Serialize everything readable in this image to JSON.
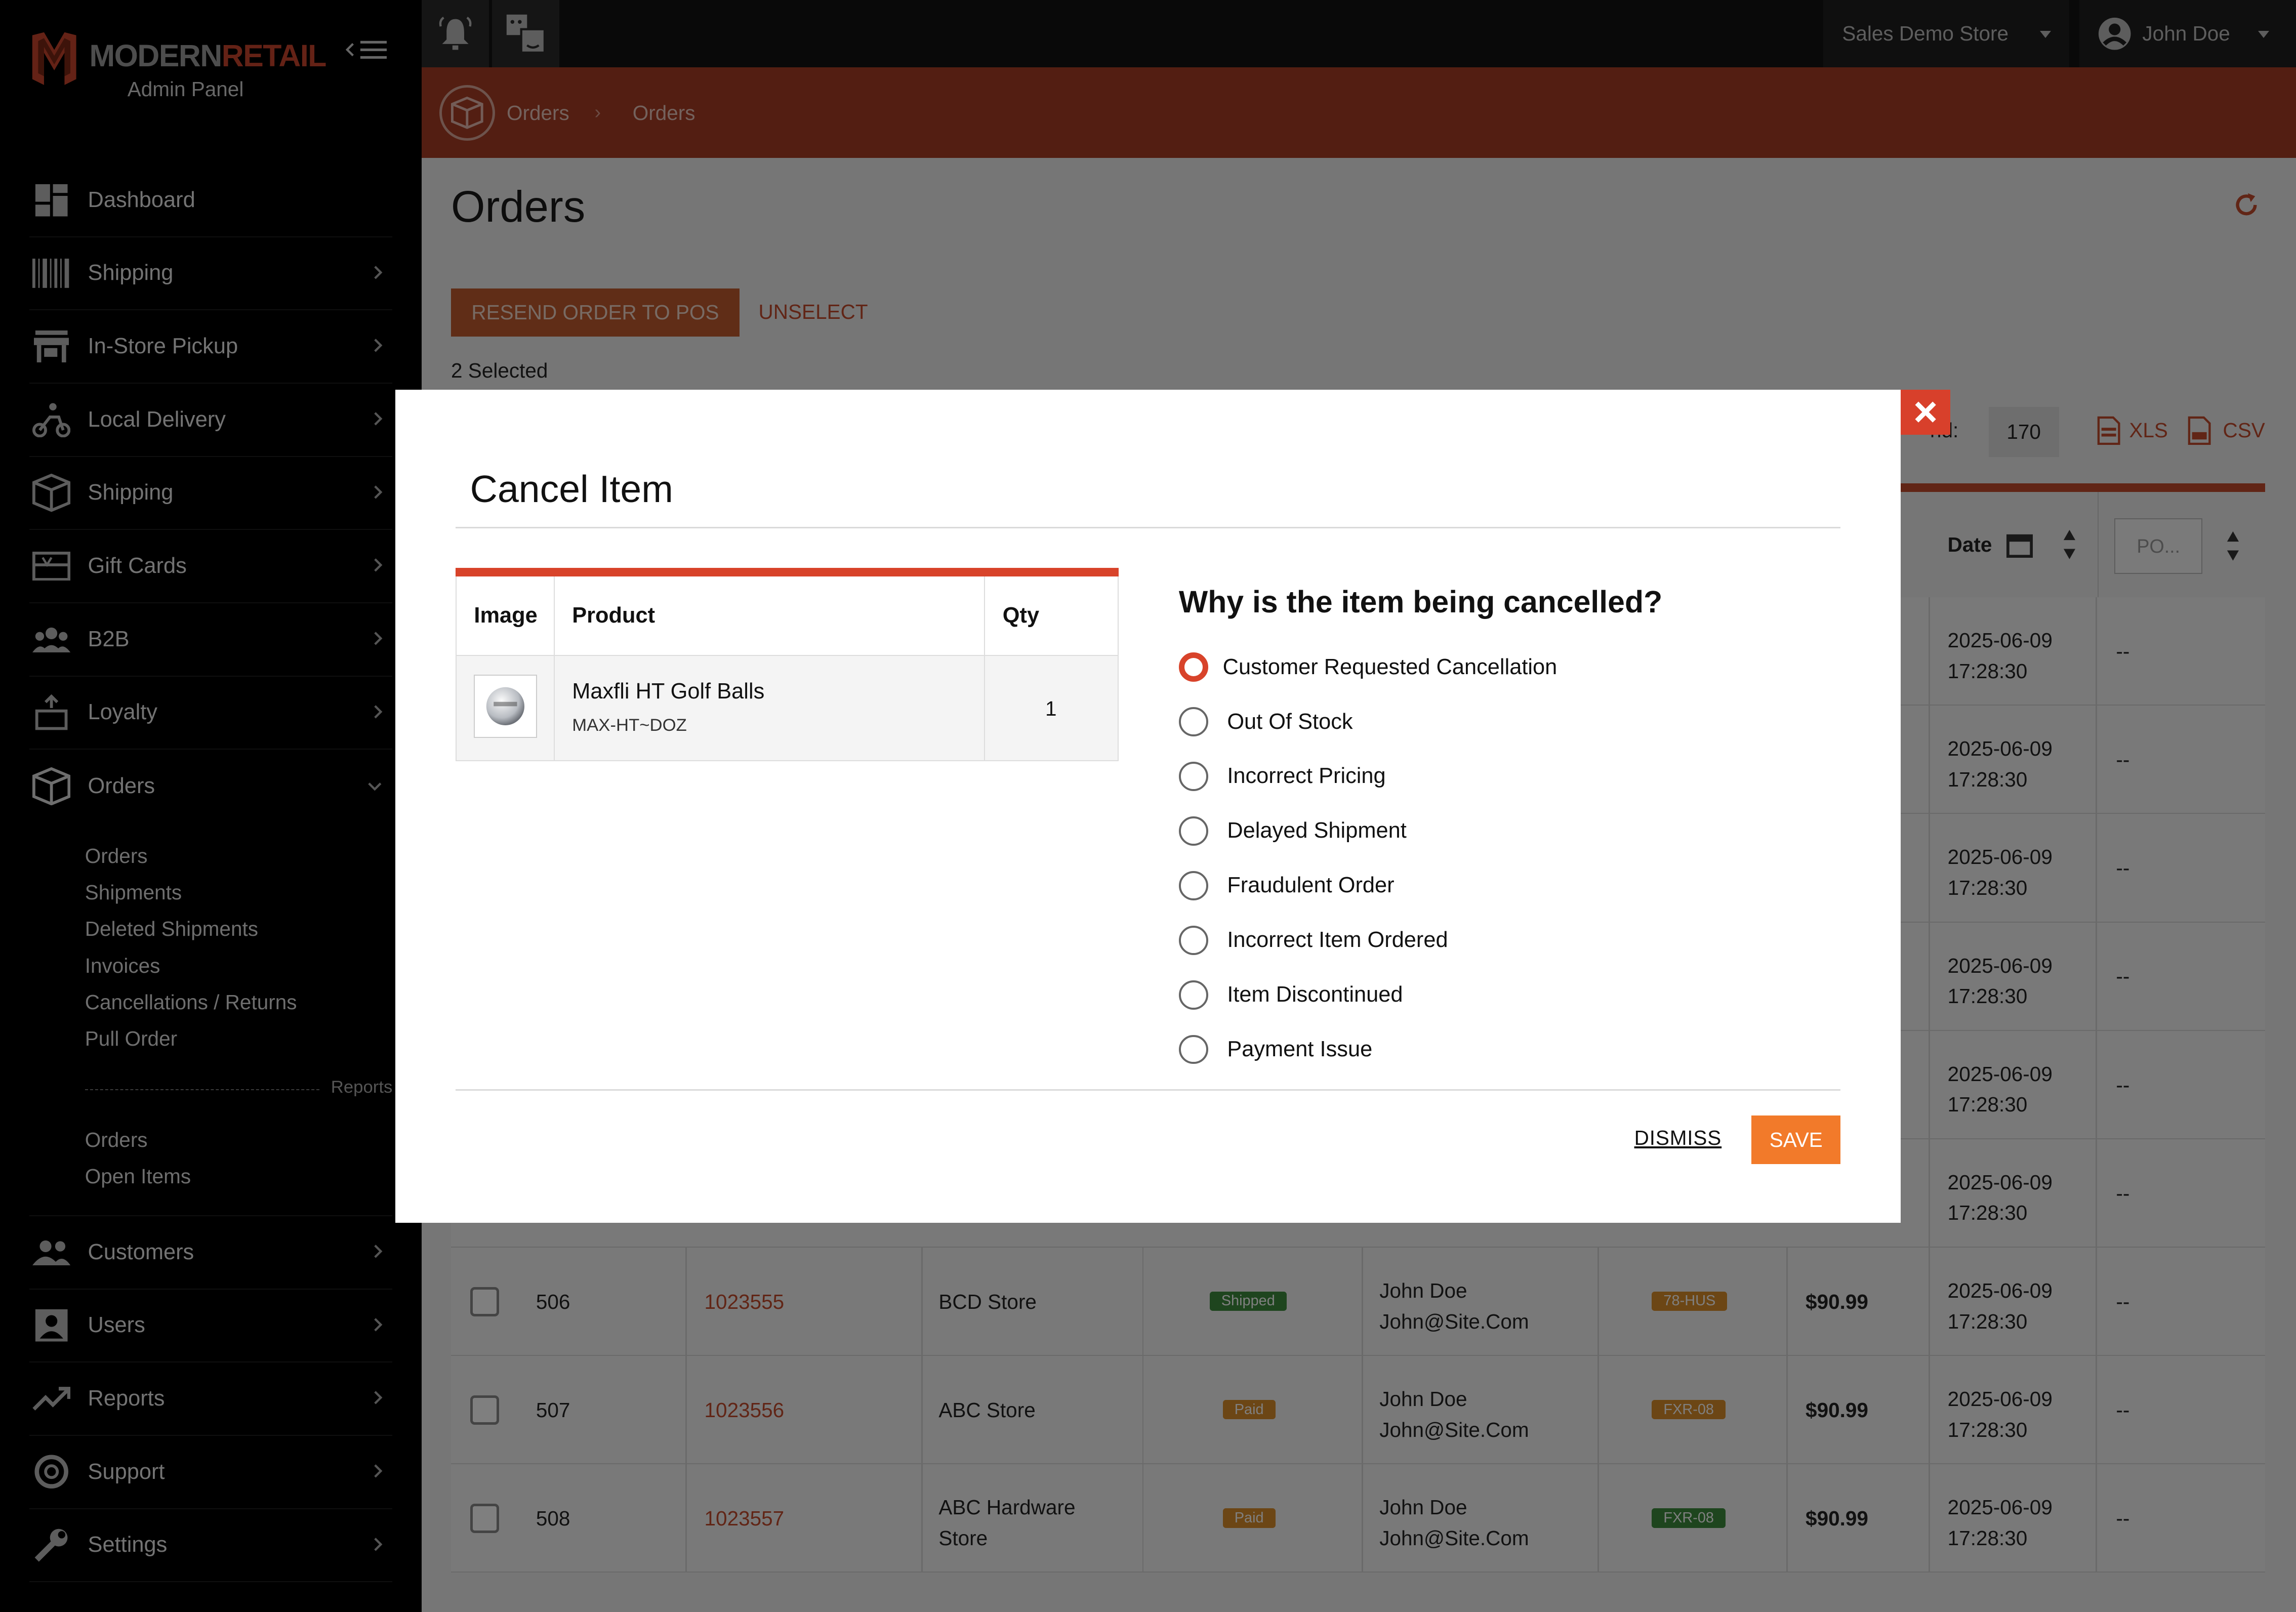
{
  "brand": {
    "part1": "MODERN",
    "part2": "RETAIL",
    "subtitle": "Admin Panel"
  },
  "topbar": {
    "store": "Sales Demo Store",
    "user": "John Doe"
  },
  "breadcrumb": {
    "items": [
      "Orders",
      "Orders"
    ],
    "separator": "›"
  },
  "sidebar": {
    "items": [
      {
        "label": "Dashboard",
        "icon": "dashboard-icon"
      },
      {
        "label": "Shipping",
        "icon": "barcode-icon"
      },
      {
        "label": "In-Store Pickup",
        "icon": "store-icon"
      },
      {
        "label": "Local Delivery",
        "icon": "scooter-icon"
      },
      {
        "label": "Shipping",
        "icon": "package-icon"
      },
      {
        "label": "Gift Cards",
        "icon": "gift-card-icon"
      },
      {
        "label": "B2B",
        "icon": "group-icon"
      },
      {
        "label": "Loyalty",
        "icon": "loyalty-icon"
      },
      {
        "label": "Orders",
        "icon": "orders-icon"
      }
    ],
    "orders_sub": [
      "Orders",
      "Shipments",
      "Deleted Shipments",
      "Invoices",
      "Cancellations / Returns",
      "Pull Order"
    ],
    "reports_label": "Reports",
    "reports_sub": [
      "Orders",
      "Open Items"
    ],
    "items_bottom": [
      {
        "label": "Customers",
        "icon": "customers-icon"
      },
      {
        "label": "Users",
        "icon": "user-icon"
      },
      {
        "label": "Reports",
        "icon": "trend-icon"
      },
      {
        "label": "Support",
        "icon": "lifebuoy-icon"
      },
      {
        "label": "Settings",
        "icon": "wrench-icon"
      }
    ]
  },
  "main": {
    "title": "Orders",
    "resend_label": "RESEND ORDER TO POS",
    "unselect_label": "UNSELECT",
    "selected_text": "2 Selected",
    "found_label": "nd:",
    "found_value": "170",
    "export_xls": "XLS",
    "export_csv": "CSV",
    "col_date": "Date",
    "col_po": "PO..."
  },
  "rows_hidden": [
    {
      "date": "2025-06-09",
      "time": "17:28:30",
      "po": "--"
    },
    {
      "date": "2025-06-09",
      "time": "17:28:30",
      "po": "--"
    },
    {
      "date": "2025-06-09",
      "time": "17:28:30",
      "po": "--"
    },
    {
      "date": "2025-06-09",
      "time": "17:28:30",
      "po": "--"
    },
    {
      "date": "2025-06-09",
      "time": "17:28:30",
      "po": "--"
    },
    {
      "date": "2025-06-09",
      "time": "17:28:30",
      "po": "--"
    }
  ],
  "rows": [
    {
      "id": "506",
      "order": "1023555",
      "store": "BCD Store",
      "store2": "",
      "status": "Shipped",
      "status_color": "#3d8a3d",
      "customer": "John Doe",
      "email": "John@Site.Com",
      "tag": "78-HUS",
      "tag_color": "#d98c2a",
      "total": "$90.99",
      "date": "2025-06-09",
      "time": "17:28:30",
      "po": "--"
    },
    {
      "id": "507",
      "order": "1023556",
      "store": "ABC Store",
      "store2": "",
      "status": "Paid",
      "status_color": "#d98c2a",
      "customer": "John Doe",
      "email": "John@Site.Com",
      "tag": "FXR-08",
      "tag_color": "#d98c2a",
      "total": "$90.99",
      "date": "2025-06-09",
      "time": "17:28:30",
      "po": "--"
    },
    {
      "id": "508",
      "order": "1023557",
      "store": "ABC Hardware",
      "store2": "Store",
      "status": "Paid",
      "status_color": "#d98c2a",
      "customer": "John Doe",
      "email": "John@Site.Com",
      "tag": "FXR-08",
      "tag_color": "#3d8a3d",
      "total": "$90.99",
      "date": "2025-06-09",
      "time": "17:28:30",
      "po": "--"
    }
  ],
  "modal": {
    "title": "Cancel Item",
    "table_headers": [
      "Image",
      "Product",
      "Qty"
    ],
    "item": {
      "name": "Maxfli HT Golf Balls",
      "sku": "MAX-HT~DOZ",
      "qty": "1"
    },
    "question": "Why is the item being cancelled?",
    "reasons": [
      "Customer Requested Cancellation",
      "Out Of Stock",
      "Incorrect Pricing",
      "Delayed Shipment",
      "Fraudulent Order",
      "Incorrect Item Ordered",
      "Item Discontinued",
      "Payment Issue"
    ],
    "selected_reason": "Customer Requested Cancellation",
    "dismiss_label": "DISMISS",
    "save_label": "SAVE"
  },
  "colors": {
    "accent": "#d8432a",
    "save": "#f27a2a",
    "crumbbar": "#a63d24"
  }
}
